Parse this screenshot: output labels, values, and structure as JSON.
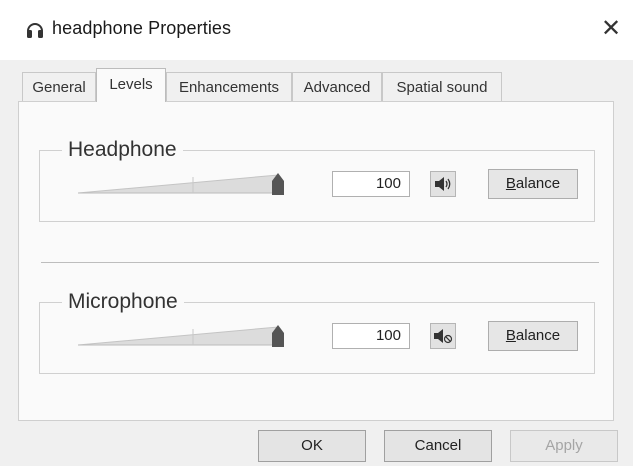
{
  "window": {
    "title": "headphone Properties",
    "close_symbol": "✕",
    "title_icon": "headphone-icon"
  },
  "tabs": [
    {
      "label": "General",
      "active": false
    },
    {
      "label": "Levels",
      "active": true
    },
    {
      "label": "Enhancements",
      "active": false
    },
    {
      "label": "Advanced",
      "active": false
    },
    {
      "label": "Spatial sound",
      "active": false
    }
  ],
  "levels": {
    "headphone": {
      "label": "Headphone",
      "value": "100",
      "level": 1.0,
      "muted": false,
      "speaker_icon": "speaker-icon",
      "balance_prefix": "B",
      "balance_rest": "alance"
    },
    "microphone": {
      "label": "Microphone",
      "value": "100",
      "level": 1.0,
      "muted": true,
      "speaker_icon": "speaker-muted-icon",
      "balance_prefix": "B",
      "balance_rest": "alance"
    }
  },
  "buttons": {
    "ok": "OK",
    "cancel": "Cancel",
    "apply": "Apply"
  },
  "colors": {
    "window_bg": "#f0f0f0",
    "panel_bg": "#fafafa",
    "slider_thumb": "#555555"
  }
}
